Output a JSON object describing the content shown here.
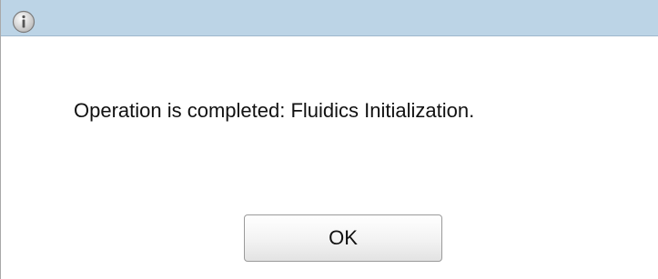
{
  "dialog": {
    "icon": "info-icon",
    "message": "Operation is completed: Fluidics Initialization.",
    "ok_label": "OK"
  },
  "colors": {
    "titlebar": "#bcd4e6",
    "background": "#ffffff",
    "text": "#111111"
  }
}
